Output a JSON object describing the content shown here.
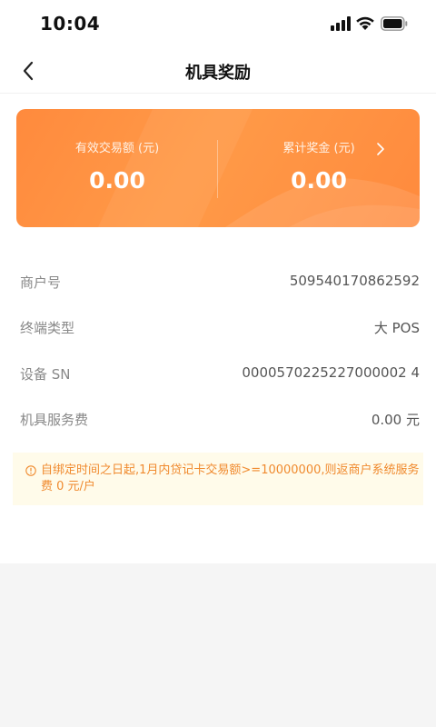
{
  "status_bar": {
    "time": "10:04"
  },
  "nav": {
    "title": "机具奖励",
    "back_icon": "chevron-left-icon"
  },
  "reward_card": {
    "left": {
      "label": "有效交易额 (元)",
      "value": "0.00"
    },
    "right": {
      "label": "累计奖金 (元)",
      "value": "0.00"
    },
    "colors": {
      "gradient_start": "#ff8a3d",
      "gradient_mid": "#ff9a48"
    }
  },
  "info": [
    {
      "label": "商户号",
      "value": "509540170862592"
    },
    {
      "label": "终端类型",
      "value": "大 POS"
    },
    {
      "label": "设备 SN",
      "value": "0000570225227000002 4"
    },
    {
      "label": "机具服务费",
      "value": "0.00 元"
    }
  ],
  "notice": {
    "icon": "warning-circle-icon",
    "text": "自绑定时间之日起,1月内贷记卡交易额>=10000000,则返商户系统服务费 0 元/户",
    "color": "#f08a2e",
    "background": "#fffbea"
  }
}
